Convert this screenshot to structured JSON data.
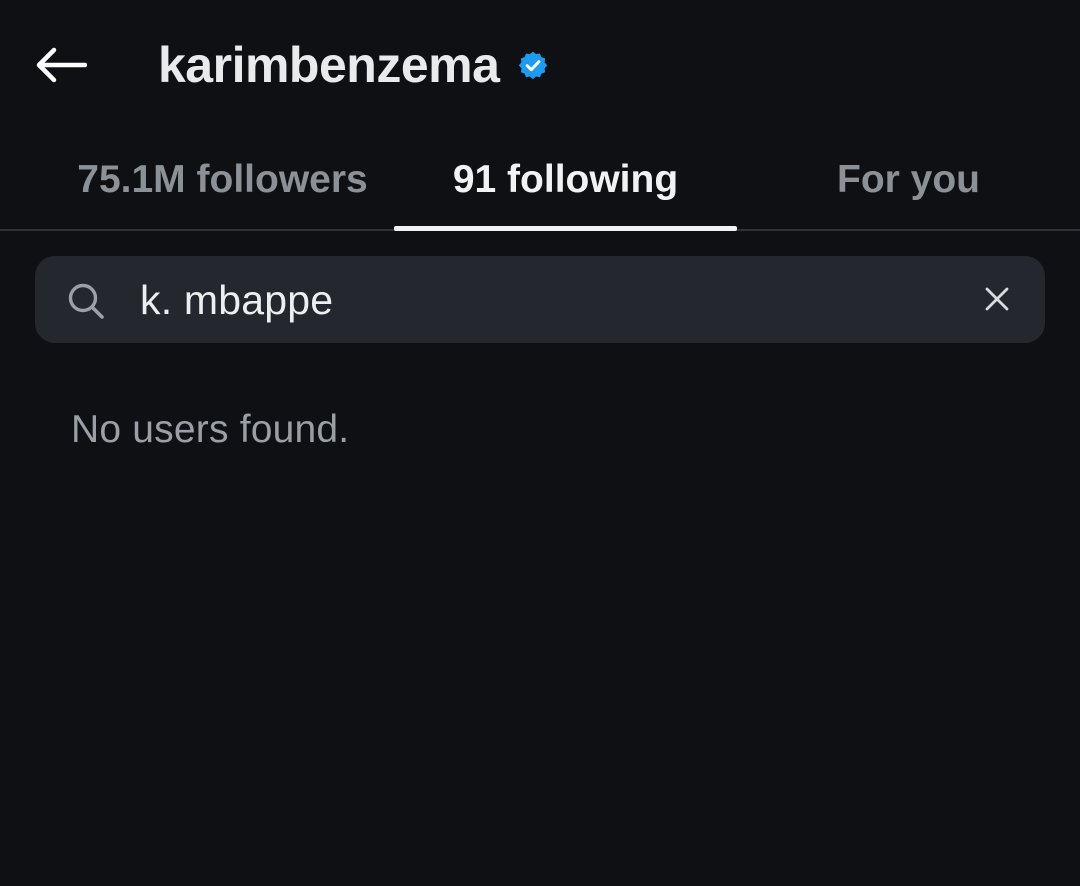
{
  "header": {
    "back_icon": "arrow-left-icon",
    "username": "karimbenzema",
    "verified_icon": "verified-badge-icon",
    "verified_color": "#1d9bf0"
  },
  "tabs": [
    {
      "label": "75.1M followers",
      "active": false
    },
    {
      "label": "91 following",
      "active": true
    },
    {
      "label": "For you",
      "active": false
    }
  ],
  "search": {
    "icon": "search-icon",
    "value": "k. mbappe",
    "clear_icon": "close-icon"
  },
  "results": {
    "empty_message": "No users found."
  },
  "colors": {
    "background": "#0e1014",
    "search_background": "#24272d",
    "active_tab": "#f1f2f3",
    "inactive_tab": "#8b9197"
  }
}
